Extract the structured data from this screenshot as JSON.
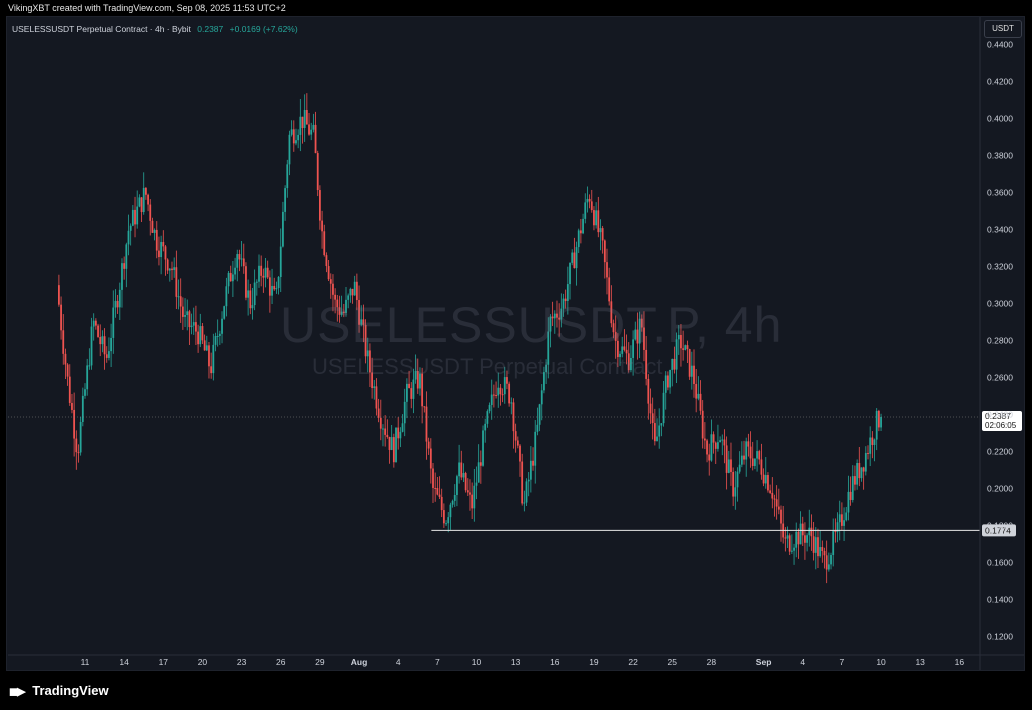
{
  "header": {
    "attribution": "VikingXBT created with TradingView.com, Sep 08, 2025 11:53 UTC+2"
  },
  "symbol_bar": {
    "name": "USELESSUSDT Perpetual Contract · 4h · Bybit",
    "price": "0.2387",
    "change": "+0.0169 (+7.62%)"
  },
  "watermark": {
    "line1": "USELESSUSDT.P, 4h",
    "line2": "USELESSUSDT Perpetual Contract"
  },
  "currency_button": "USDT",
  "footer": {
    "logo_text": "TradingView"
  },
  "colors": {
    "up": "#26a69a",
    "down": "#ef5350",
    "background": "#141821"
  },
  "chart_data": {
    "type": "candlestick",
    "title": "USELESSUSDT Perpetual Contract · 4h · Bybit",
    "y_axis": {
      "scale": "linear",
      "range": [
        0.11,
        0.455
      ],
      "tick_labels": [
        "0.4400",
        "0.4200",
        "0.4000",
        "0.3800",
        "0.3600",
        "0.3400",
        "0.3200",
        "0.3000",
        "0.2800",
        "0.2600",
        "0.2400",
        "0.2200",
        "0.2000",
        "0.1800",
        "0.1600",
        "0.1400",
        "0.1200"
      ],
      "tick_values": [
        0.44,
        0.42,
        0.4,
        0.38,
        0.36,
        0.34,
        0.32,
        0.3,
        0.28,
        0.26,
        0.24,
        0.22,
        0.2,
        0.18,
        0.16,
        0.14,
        0.12
      ]
    },
    "x_axis": {
      "tick_labels": [
        "11",
        "14",
        "17",
        "20",
        "23",
        "26",
        "29",
        "Aug",
        "4",
        "7",
        "10",
        "13",
        "16",
        "19",
        "22",
        "25",
        "28",
        "Sep",
        "4",
        "7",
        "10",
        "13",
        "16"
      ],
      "bold_labels": [
        "Aug",
        "Sep"
      ]
    },
    "current_price": {
      "value": 0.2387,
      "label": "0.2387",
      "countdown": "02:06:05"
    },
    "horizontal_line": {
      "value": 0.1774,
      "label": "0.1774",
      "start_tick": "7"
    },
    "price_path_keypoints": [
      {
        "day": 9.0,
        "price": 0.31
      },
      {
        "day": 9.8,
        "price": 0.26
      },
      {
        "day": 10.6,
        "price": 0.22
      },
      {
        "day": 11.8,
        "price": 0.29
      },
      {
        "day": 12.8,
        "price": 0.27
      },
      {
        "day": 13.8,
        "price": 0.31
      },
      {
        "day": 14.5,
        "price": 0.34
      },
      {
        "day": 15.8,
        "price": 0.36
      },
      {
        "day": 16.6,
        "price": 0.335
      },
      {
        "day": 17.8,
        "price": 0.32
      },
      {
        "day": 18.8,
        "price": 0.29
      },
      {
        "day": 19.8,
        "price": 0.285
      },
      {
        "day": 20.8,
        "price": 0.265
      },
      {
        "day": 21.8,
        "price": 0.3
      },
      {
        "day": 22.8,
        "price": 0.33
      },
      {
        "day": 23.8,
        "price": 0.3
      },
      {
        "day": 24.8,
        "price": 0.32
      },
      {
        "day": 25.8,
        "price": 0.3
      },
      {
        "day": 26.8,
        "price": 0.39
      },
      {
        "day": 27.8,
        "price": 0.4
      },
      {
        "day": 28.7,
        "price": 0.39
      },
      {
        "day": 29.3,
        "price": 0.34
      },
      {
        "day": 30.3,
        "price": 0.3
      },
      {
        "day": 31.0,
        "price": 0.295
      },
      {
        "day": 31.8,
        "price": 0.31
      },
      {
        "day": 32.8,
        "price": 0.27
      },
      {
        "day": 33.8,
        "price": 0.24
      },
      {
        "day": 34.8,
        "price": 0.22
      },
      {
        "day": 35.8,
        "price": 0.25
      },
      {
        "day": 36.8,
        "price": 0.26
      },
      {
        "day": 37.8,
        "price": 0.2
      },
      {
        "day": 38.8,
        "price": 0.184
      },
      {
        "day": 39.8,
        "price": 0.21
      },
      {
        "day": 40.8,
        "price": 0.19
      },
      {
        "day": 41.8,
        "price": 0.23
      },
      {
        "day": 42.8,
        "price": 0.26
      },
      {
        "day": 43.8,
        "price": 0.25
      },
      {
        "day": 44.8,
        "price": 0.19
      },
      {
        "day": 45.8,
        "price": 0.23
      },
      {
        "day": 46.8,
        "price": 0.29
      },
      {
        "day": 47.8,
        "price": 0.3
      },
      {
        "day": 48.8,
        "price": 0.33
      },
      {
        "day": 49.8,
        "price": 0.36
      },
      {
        "day": 50.8,
        "price": 0.33
      },
      {
        "day": 51.8,
        "price": 0.28
      },
      {
        "day": 52.8,
        "price": 0.27
      },
      {
        "day": 53.8,
        "price": 0.29
      },
      {
        "day": 54.8,
        "price": 0.22
      },
      {
        "day": 55.8,
        "price": 0.26
      },
      {
        "day": 56.8,
        "price": 0.28
      },
      {
        "day": 57.8,
        "price": 0.26
      },
      {
        "day": 58.8,
        "price": 0.22
      },
      {
        "day": 59.8,
        "price": 0.23
      },
      {
        "day": 60.8,
        "price": 0.2
      },
      {
        "day": 61.8,
        "price": 0.22
      },
      {
        "day": 62.8,
        "price": 0.215
      },
      {
        "day": 63.8,
        "price": 0.2
      },
      {
        "day": 64.8,
        "price": 0.17
      },
      {
        "day": 65.8,
        "price": 0.175
      },
      {
        "day": 66.8,
        "price": 0.175
      },
      {
        "day": 67.8,
        "price": 0.16
      },
      {
        "day": 68.8,
        "price": 0.175
      },
      {
        "day": 69.8,
        "price": 0.2
      },
      {
        "day": 70.8,
        "price": 0.215
      },
      {
        "day": 71.8,
        "price": 0.235
      },
      {
        "day": 72.1,
        "price": 0.2387
      }
    ]
  }
}
